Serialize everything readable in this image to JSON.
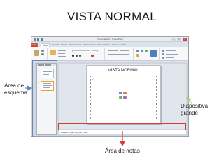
{
  "slide_heading": "VISTA NORMAL",
  "window": {
    "title": "Presentación1 - PowerPoint",
    "controls": [
      "–",
      "□",
      "×"
    ],
    "file_tab": "Archivo",
    "tabs": [
      "Inicio",
      "Insertar",
      "Diseño",
      "Transiciones",
      "Animaciones",
      "Presentación",
      "Revisar",
      "Vista"
    ],
    "active_tab": "Inicio"
  },
  "slide": {
    "title": "VISTA NORMAL",
    "bullet": "•"
  },
  "notes_placeholder": "Haga clic para agregar notas",
  "thumbnails": [
    "1",
    "2"
  ],
  "labels": {
    "outline_area": "Área de esquema",
    "large_slide": "Diapositiva grande",
    "notes_area": "Área de notas"
  },
  "colors": {
    "outline_highlight": "#6d82b6",
    "slide_highlight": "#a5cf82",
    "notes_highlight": "#d63a3a",
    "file_tab": "#d24726"
  }
}
